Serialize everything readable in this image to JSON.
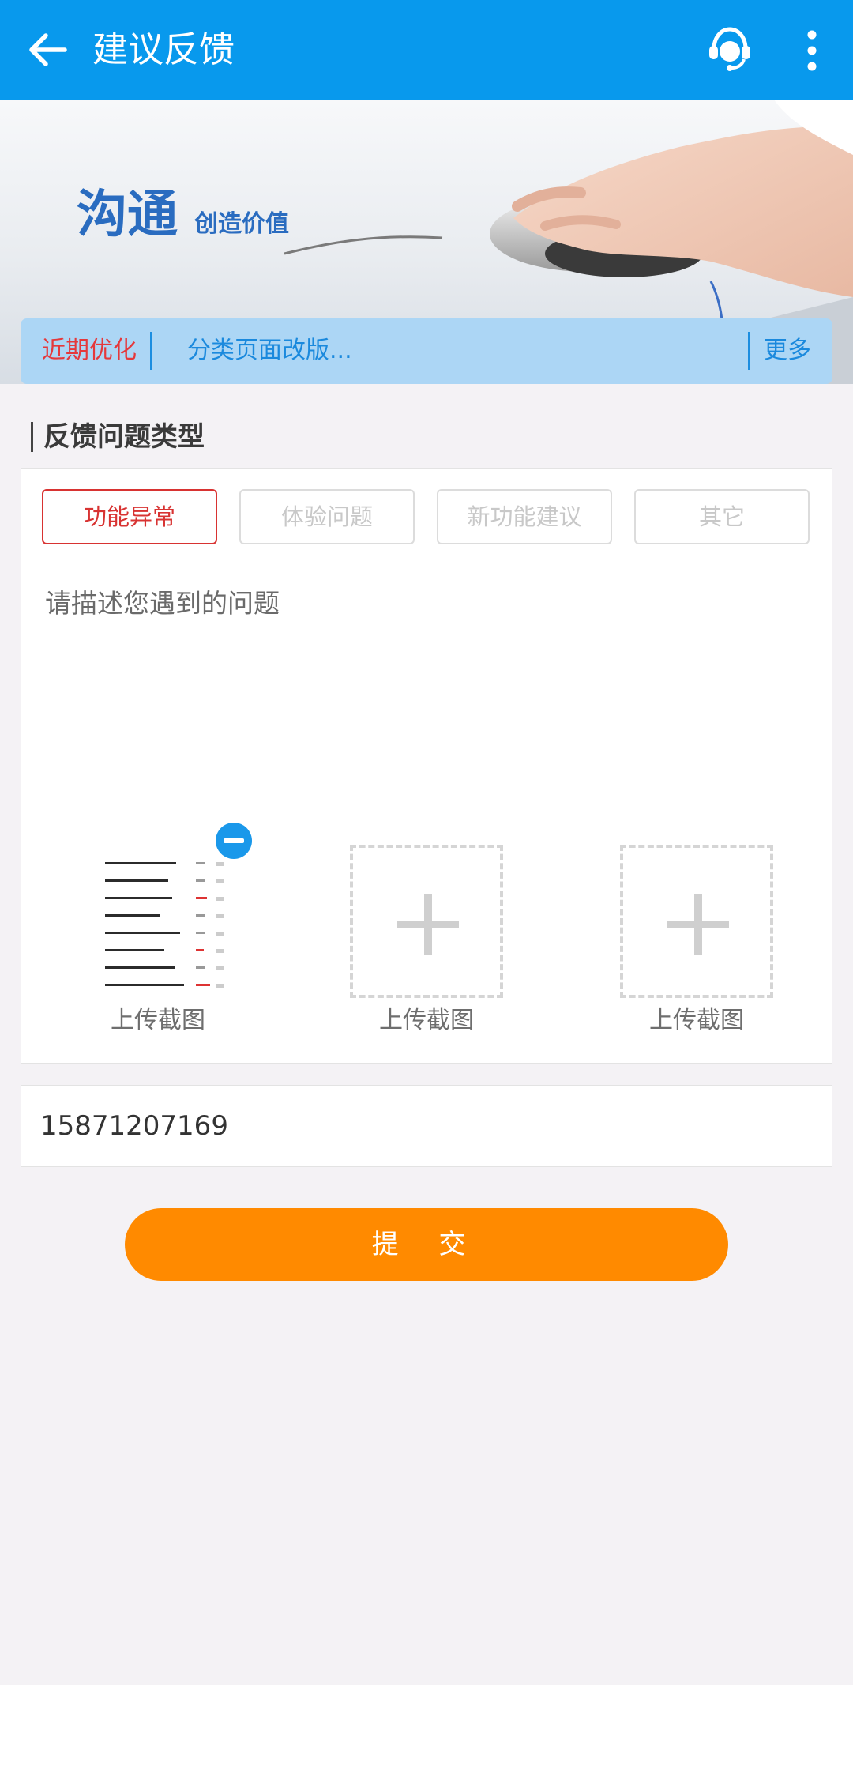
{
  "header": {
    "title": "建议反馈",
    "icons": [
      "back-arrow-icon",
      "customer-service-icon",
      "more-vertical-icon"
    ]
  },
  "banner": {
    "headline": "沟通",
    "tagline": "创造价值"
  },
  "notice": {
    "tag": "近期优化",
    "text": "分类页面改版...",
    "more": "更多"
  },
  "feedback_type": {
    "section_title": "反馈问题类型",
    "options": [
      "功能异常",
      "体验问题",
      "新功能建议",
      "其它"
    ],
    "selected": "功能异常"
  },
  "description": {
    "placeholder": "请描述您遇到的问题"
  },
  "screenshots": {
    "slots": [
      {
        "label": "上传截图",
        "state": "uploaded"
      },
      {
        "label": "上传截图",
        "state": "empty"
      },
      {
        "label": "上传截图",
        "state": "empty"
      }
    ]
  },
  "contact": {
    "value": "15871207169"
  },
  "submit": {
    "label": "提 交"
  },
  "colors": {
    "appbar": "#0899ed",
    "accent_red": "#d83332",
    "submit_orange": "#ff8a00",
    "notice_bg": "#acd6f5"
  }
}
